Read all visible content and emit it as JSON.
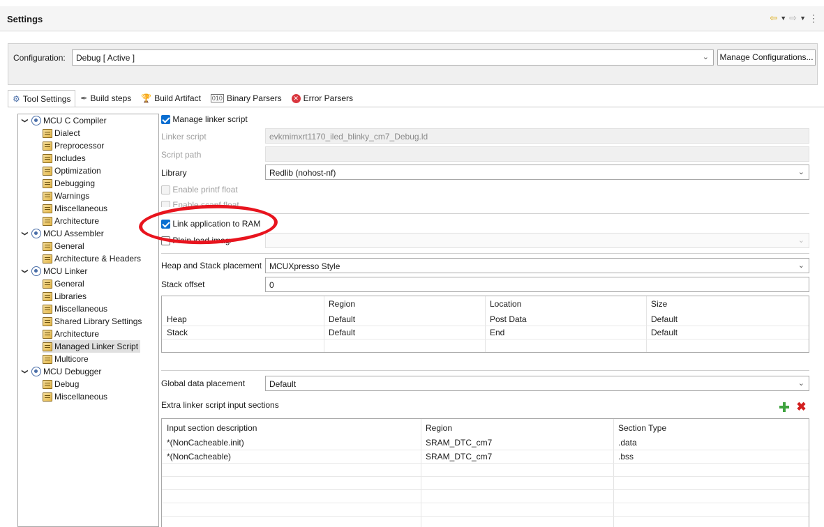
{
  "window": {
    "title": "Settings",
    "nav_back_glyph": "⇦",
    "nav_fwd_glyph": "⇨",
    "dropdown_glyph": "▼",
    "menu_glyph": "⋮"
  },
  "configuration": {
    "label": "Configuration:",
    "value": "Debug  [ Active ]",
    "manage_button": "Manage Configurations..."
  },
  "tabs": [
    {
      "label": "Tool Settings",
      "icon": "gear-icon",
      "active": true
    },
    {
      "label": "Build steps",
      "icon": "hammer-icon"
    },
    {
      "label": "Build Artifact",
      "icon": "trophy-icon"
    },
    {
      "label": "Binary Parsers",
      "icon": "binary-icon"
    },
    {
      "label": "Error Parsers",
      "icon": "error-icon"
    }
  ],
  "tree": [
    {
      "label": "MCU C Compiler",
      "level": 0
    },
    {
      "label": "Dialect",
      "level": 1
    },
    {
      "label": "Preprocessor",
      "level": 1
    },
    {
      "label": "Includes",
      "level": 1
    },
    {
      "label": "Optimization",
      "level": 1
    },
    {
      "label": "Debugging",
      "level": 1
    },
    {
      "label": "Warnings",
      "level": 1
    },
    {
      "label": "Miscellaneous",
      "level": 1
    },
    {
      "label": "Architecture",
      "level": 1
    },
    {
      "label": "MCU Assembler",
      "level": 0
    },
    {
      "label": "General",
      "level": 1
    },
    {
      "label": "Architecture & Headers",
      "level": 1
    },
    {
      "label": "MCU Linker",
      "level": 0
    },
    {
      "label": "General",
      "level": 1
    },
    {
      "label": "Libraries",
      "level": 1
    },
    {
      "label": "Miscellaneous",
      "level": 1
    },
    {
      "label": "Shared Library Settings",
      "level": 1
    },
    {
      "label": "Architecture",
      "level": 1
    },
    {
      "label": "Managed Linker Script",
      "level": 1,
      "selected": true
    },
    {
      "label": "Multicore",
      "level": 1
    },
    {
      "label": "MCU Debugger",
      "level": 0
    },
    {
      "label": "Debug",
      "level": 1
    },
    {
      "label": "Miscellaneous",
      "level": 1
    }
  ],
  "panel": {
    "manage_linker_script": "Manage linker script",
    "linker_script_label": "Linker script",
    "linker_script_value": "evkmimxrt1170_iled_blinky_cm7_Debug.ld",
    "script_path_label": "Script path",
    "script_path_value": "",
    "library_label": "Library",
    "library_value": "Redlib (nohost-nf)",
    "enable_printf_float": "Enable printf float",
    "enable_scanf_float": "Enable scanf float",
    "link_app_to_ram": "Link application to RAM",
    "plain_load_image": "Plain load image",
    "heap_stack_label": "Heap and Stack placement",
    "heap_stack_value": "MCUXpresso Style",
    "stack_offset_label": "Stack offset",
    "stack_offset_value": "0",
    "heap_table": {
      "headers": [
        "",
        "Region",
        "Location",
        "Size"
      ],
      "rows": [
        [
          "Heap",
          "Default",
          "Post Data",
          "Default"
        ],
        [
          "Stack",
          "Default",
          "End",
          "Default"
        ]
      ]
    },
    "global_data_label": "Global data placement",
    "global_data_value": "Default",
    "extra_sections_label": "Extra linker script input sections",
    "sections_table": {
      "headers": [
        "Input section description",
        "Region",
        "Section Type"
      ],
      "rows": [
        [
          "*(NonCacheable.init)",
          "SRAM_DTC_cm7",
          ".data"
        ],
        [
          "*(NonCacheable)",
          "SRAM_DTC_cm7",
          ".bss"
        ]
      ]
    }
  },
  "colors": {
    "accent": "#0a6ed1",
    "annotation_ring": "#e8141e"
  }
}
